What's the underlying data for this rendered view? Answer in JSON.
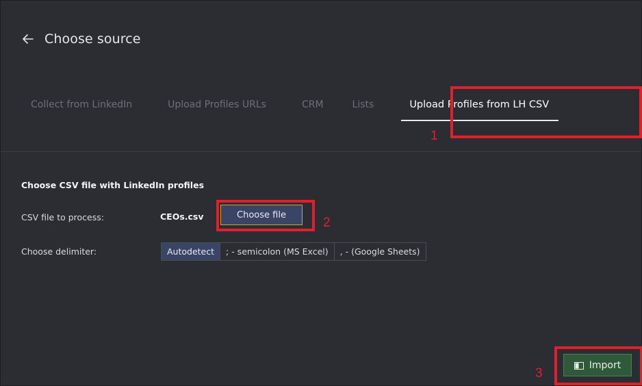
{
  "header": {
    "back_icon": "arrow-left-icon",
    "title": "Choose source"
  },
  "tabs": [
    {
      "label": "Collect from LinkedIn",
      "active": false
    },
    {
      "label": "Upload Profiles URLs",
      "active": false
    },
    {
      "label": "CRM",
      "active": false
    },
    {
      "label": "Lists",
      "active": false
    },
    {
      "label": "Upload Profiles from LH CSV",
      "active": true
    }
  ],
  "form": {
    "section_title": "Choose CSV file with LinkedIn profiles",
    "file_label": "CSV file to process:",
    "file_name": "CEOs.csv",
    "choose_file_label": "Choose file",
    "delimiter_label": "Choose delimiter:",
    "delimiters": [
      {
        "label": "Autodetect",
        "active": true
      },
      {
        "label": "; - semicolon (MS Excel)",
        "active": false
      },
      {
        "label": ", - (Google Sheets)",
        "active": false
      }
    ]
  },
  "import": {
    "icon": "import-icon",
    "label": "Import"
  },
  "annotations": {
    "step1": "1",
    "step2": "2",
    "step3": "3",
    "color": "#e3202a"
  },
  "colors": {
    "background": "#2b2d33",
    "active_blue": "#3a4566",
    "import_green": "#2f5a3a"
  }
}
